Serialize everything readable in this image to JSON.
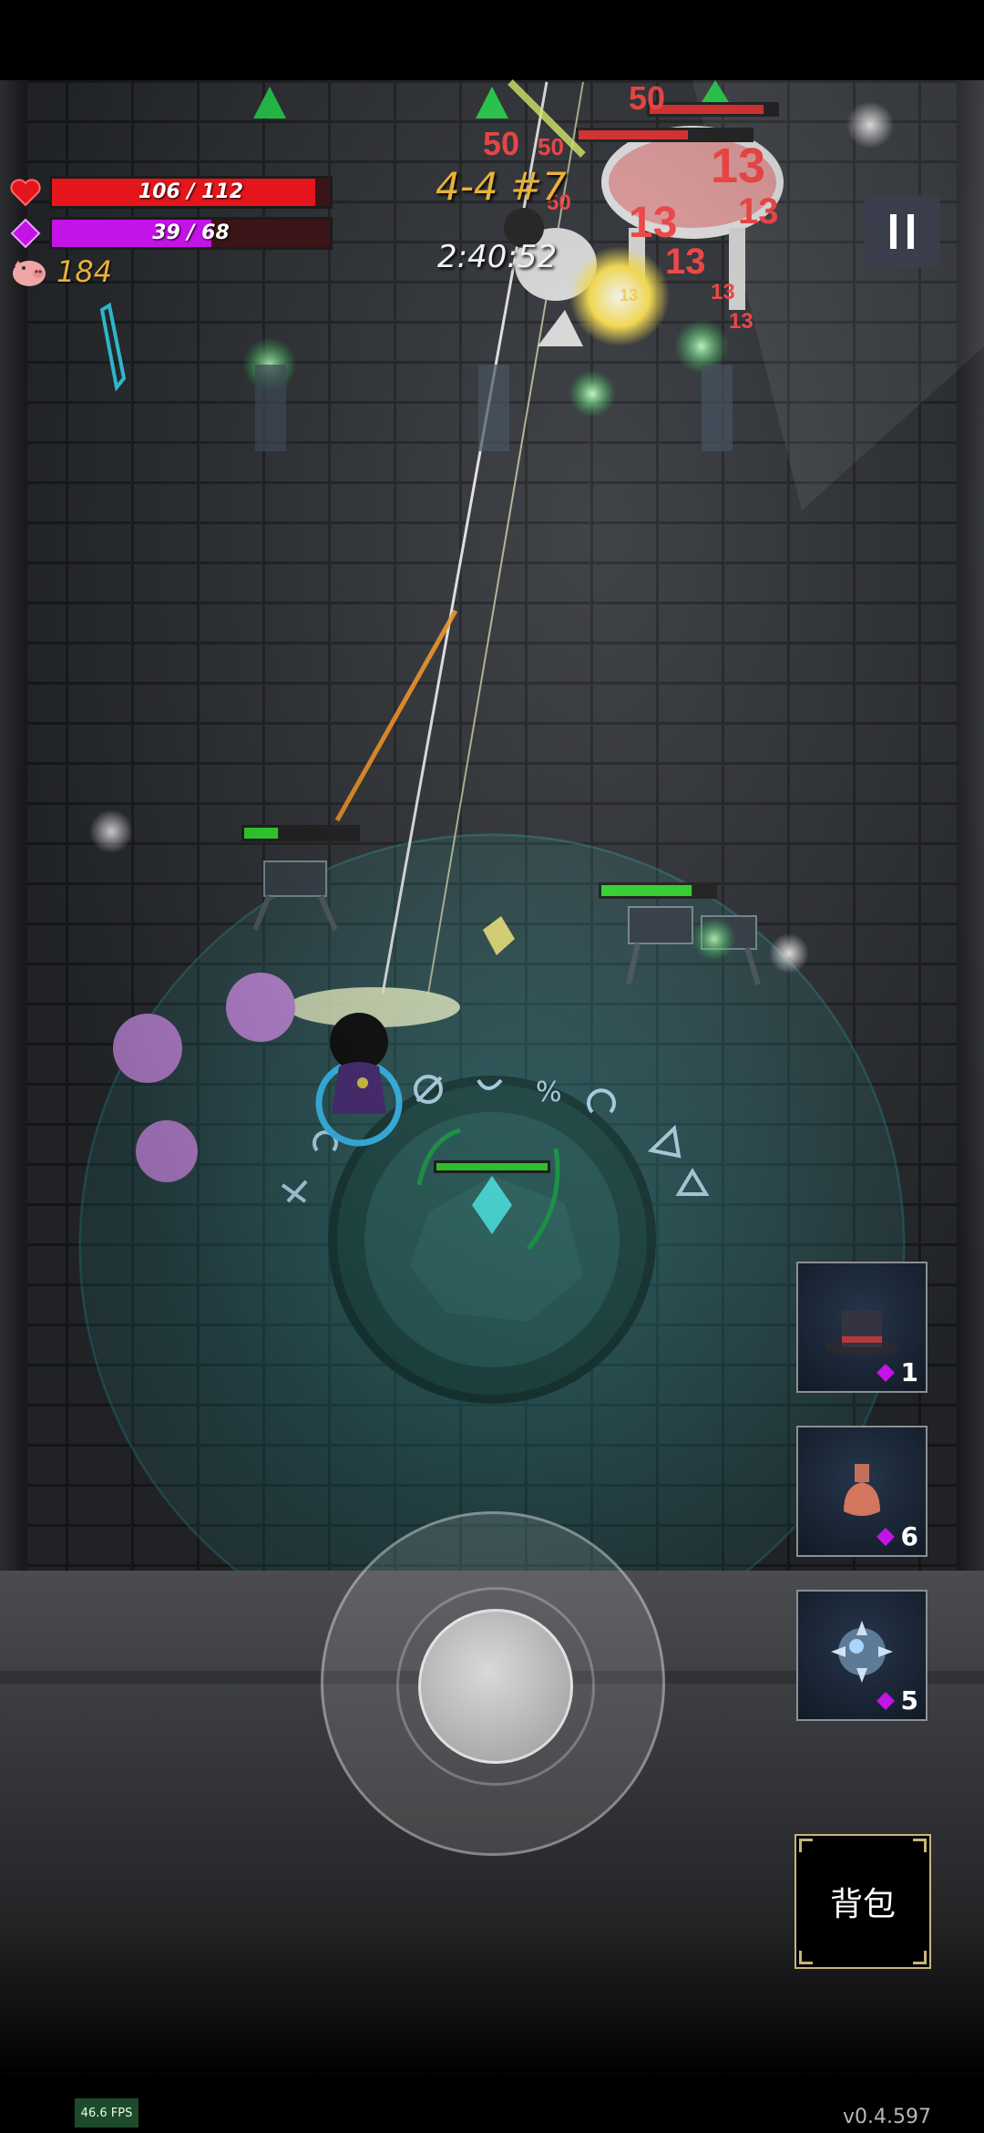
{
  "hud": {
    "hp_text": "106 / 112",
    "hp_fraction": 0.946,
    "mp_text": "39 / 68",
    "mp_fraction": 0.574,
    "gold": "184",
    "level": "4-4 #7",
    "timer": "2:40:52"
  },
  "damage_numbers": [
    "50",
    "13"
  ],
  "skills": [
    {
      "icon": "top-hat-icon",
      "cost": "1"
    },
    {
      "icon": "potion-flask-icon",
      "cost": "6"
    },
    {
      "icon": "spiked-orb-icon",
      "cost": "5"
    }
  ],
  "backpack_label": "背包",
  "fps": "46.6 FPS",
  "version": "v0.4.597",
  "enemy_health": [
    0.3,
    0.8,
    0.9
  ],
  "colors": {
    "hp": "#e5151c",
    "mp": "#c313e6",
    "gold": "#e8b23a",
    "damage": "#ff4040",
    "aura": "#2fb7b5"
  }
}
